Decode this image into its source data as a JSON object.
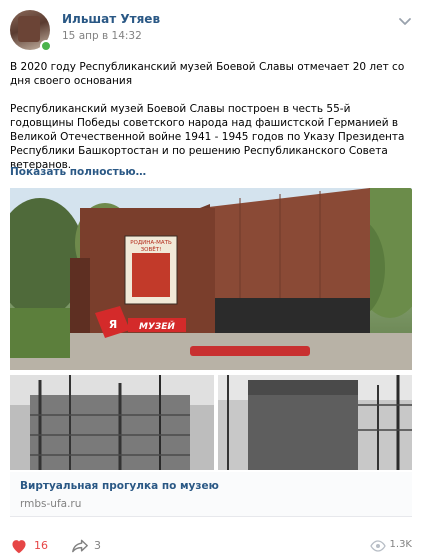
{
  "author": {
    "name": "Ильшат Утяев",
    "date": "15 апр в 14:32"
  },
  "post": {
    "paragraph1": "В 2020 году Республиканский музей Боевой Славы отмечает 20 лет со дня своего основания",
    "paragraph2": "Республиканский музей Боевой Славы построен в честь 55-й годовщины Победы советского народа над фашистской Германией в Великой Отечественной войне 1941 - 1945 годов по Указу Президента Республики Башкортостан и по решению Республиканского Совета ветеранов.",
    "show_more": "Показать полностью…"
  },
  "image_sign": {
    "poster_line1": "РОДИНА-МАТЬ",
    "poster_line2": "ЗОВЁТ!",
    "museum_letter": "Я",
    "museum_word": "МУЗЕЙ"
  },
  "link": {
    "title": "Виртуальная прогулка по музею",
    "domain": "rmbs-ufa.ru"
  },
  "stats": {
    "likes": "16",
    "shares": "3",
    "views": "1.3K"
  },
  "colors": {
    "link": "#2a5885",
    "like": "#e64646",
    "muted": "#828282",
    "online": "#4bb34b"
  }
}
